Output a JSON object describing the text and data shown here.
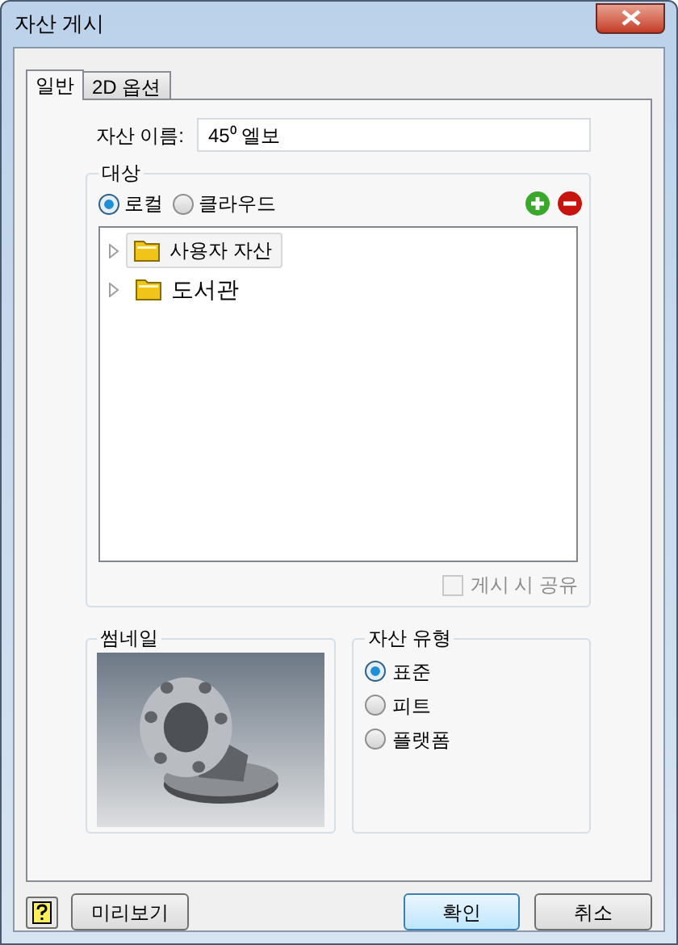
{
  "window": {
    "title": "자산 게시"
  },
  "tabs": [
    {
      "label": "일반",
      "selected": true
    },
    {
      "label": "2D 옵션",
      "selected": false
    }
  ],
  "asset_name": {
    "label": "자산 이름:",
    "value": "45⁰ 엘보"
  },
  "target": {
    "title": "대상",
    "locations": [
      {
        "label": "로컬",
        "selected": true
      },
      {
        "label": "클라우드",
        "selected": false
      }
    ],
    "tree": [
      {
        "label": "사용자 자산",
        "selected": true,
        "expanded": false
      },
      {
        "label": "도서관",
        "selected": false,
        "expanded": false
      }
    ],
    "share_on_publish": {
      "label": "게시 시 공유",
      "checked": false,
      "disabled": true
    }
  },
  "thumbnail": {
    "title": "썸네일",
    "kind": "picture"
  },
  "asset_type": {
    "title": "자산 유형",
    "options": [
      {
        "label": "표준",
        "selected": true
      },
      {
        "label": "피트",
        "selected": false
      },
      {
        "label": "플랫폼",
        "selected": false
      }
    ]
  },
  "buttons": {
    "preview": "미리보기",
    "ok": "확인",
    "cancel": "취소"
  }
}
